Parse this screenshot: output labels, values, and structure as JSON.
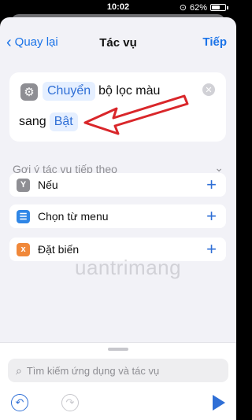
{
  "status": {
    "time": "10:02",
    "battery": "62%",
    "battery_level": 0.62
  },
  "nav": {
    "back_label": "Quay lại",
    "title": "Tác vụ",
    "next_label": "Tiếp"
  },
  "action": {
    "token1": "Chuyển",
    "text1": "bộ lọc màu",
    "text2": "sang",
    "token2": "Bật"
  },
  "suggestions": {
    "header": "Gợi ý tác vụ tiếp theo",
    "items": [
      {
        "label": "Nếu",
        "icon": "branch-icon",
        "color": "#8e8e93"
      },
      {
        "label": "Chọn từ menu",
        "icon": "menu-icon",
        "color": "#2f86e6"
      },
      {
        "label": "Đặt biến",
        "icon": "variable-icon",
        "color": "#f0883a"
      }
    ]
  },
  "watermark": "uantrimang",
  "search": {
    "placeholder": "Tìm kiếm ứng dụng và tác vụ"
  },
  "colors": {
    "accent": "#2f6fd6",
    "arrow": "#d9262a"
  }
}
